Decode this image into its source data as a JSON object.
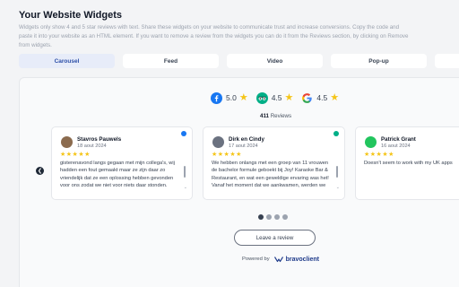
{
  "header": {
    "title": "Your Website Widgets",
    "description": "Widgets only show 4 and 5 star reviews with text. Share these widgets on your website to communicate trust and increase conversions. Copy the code and paste it into your website as an HTML element. If you want to remove a review from the widgets you can do it from the Reviews section, by clicking on Remove from widgets."
  },
  "tabs": [
    {
      "label": "Carousel",
      "active": true
    },
    {
      "label": "Feed",
      "active": false
    },
    {
      "label": "Video",
      "active": false
    },
    {
      "label": "Pop-up",
      "active": false
    },
    {
      "label": "",
      "active": false
    }
  ],
  "ratings": [
    {
      "source": "facebook-icon",
      "value": "5.0"
    },
    {
      "source": "tripadvisor-icon",
      "value": "4.5"
    },
    {
      "source": "google-icon",
      "value": "4.5"
    }
  ],
  "total": {
    "count": "411",
    "label": "Reviews"
  },
  "reviews": [
    {
      "name": "Stavros Pauwels",
      "date": "18 aout 2024",
      "stars": "★★★★★",
      "source": "facebook",
      "text": "gisterenavond langs gegaan met mijn collega's, wij hadden een fout gemaakt maar ze zijn daar zo vriendelijk dat ze een oplossing hebben gevonden voor ons zodat we niet voor niets daar stonden. Heel leuk, ik raad deze plek aan als je een"
    },
    {
      "name": "Dirk en Cindy",
      "date": "17 aout 2024",
      "stars": "★★★★★",
      "source": "tripadvisor",
      "text": "We hebben onlangs met een groep van 11 vrouwen de bachelor formule geboekt bij Joy! Karaoke Bar & Restaurant, en wat een geweldige ervaring was het! Vanaf het moment dat we aankwamen, werden we met een warm welkom ontvangen door de"
    },
    {
      "name": "Patrick Grant",
      "date": "16 aout 2024",
      "stars": "★★★★★",
      "source": "google",
      "text": "Doesn't seem to work with my UK apps"
    }
  ],
  "pagination": {
    "count": 4,
    "active": 0
  },
  "leave_review_label": "Leave a review",
  "powered": {
    "label": "Powered by",
    "brand": "bravoclient"
  },
  "colors": {
    "facebook": "#1877f2",
    "tripadvisor": "#00af87",
    "google": "#4285f4",
    "star": "#f5c518",
    "accent": "#2d4fa8"
  }
}
